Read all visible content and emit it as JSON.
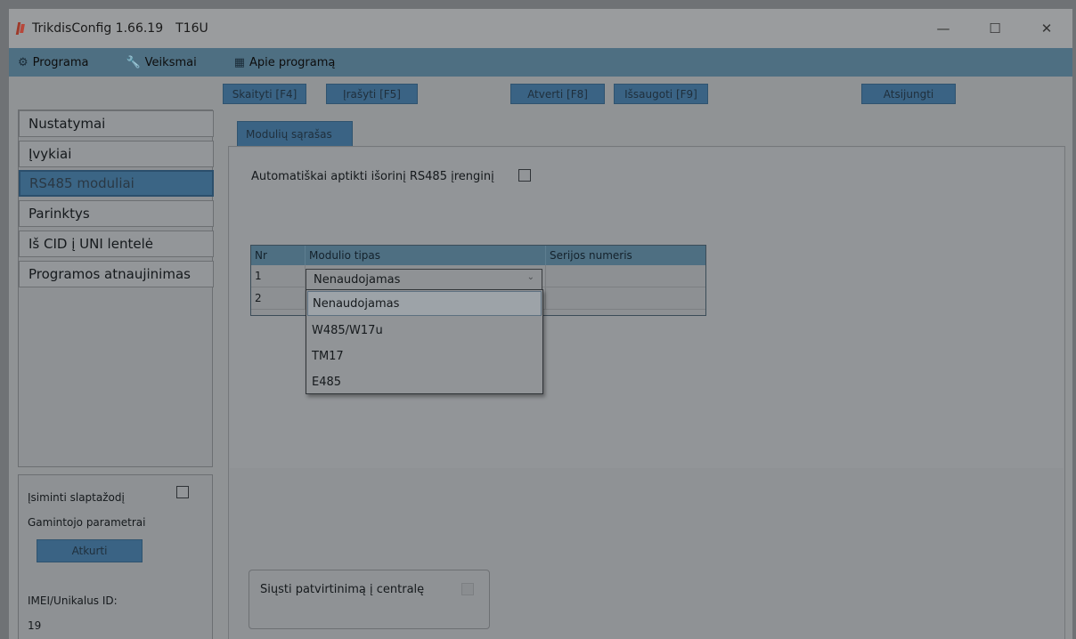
{
  "window": {
    "title": "TrikdisConfig 1.66.19",
    "device": "T16U",
    "controls": {
      "minimize": "—",
      "maximize": "☐",
      "close": "✕"
    }
  },
  "menu": {
    "items": [
      {
        "label": "Programa",
        "icon": "gear-icon"
      },
      {
        "label": "Veiksmai",
        "icon": "wrench-icon"
      },
      {
        "label": "Apie programą",
        "icon": "book-icon"
      }
    ]
  },
  "toolbar": {
    "read": "Skaityti [F4]",
    "write": "Įrašyti [F5]",
    "open": "Atverti [F8]",
    "save": "Išsaugoti [F9]",
    "disconnect": "Atsijungti"
  },
  "sidebar": {
    "items": [
      {
        "label": "Nustatymai"
      },
      {
        "label": "Įvykiai"
      },
      {
        "label": "RS485 moduliai"
      },
      {
        "label": "Parinktys"
      },
      {
        "label": "Iš CID į UNI lentelė"
      },
      {
        "label": "Programos atnaujinimas"
      }
    ],
    "active_index": 2,
    "remember_password": "Įsiminti slaptažodį",
    "factory_params": "Gamintojo parametrai",
    "restore": "Atkurti",
    "imei_label": "IMEI/Unikalus ID:",
    "imei_value": "19"
  },
  "main": {
    "tab": "Modulių sąrašas",
    "auto_detect_label": "Automatiškai aptikti išorinį RS485 įrenginį",
    "table": {
      "headers": [
        "Nr",
        "Modulio tipas",
        "Serijos numeris"
      ],
      "rows": [
        {
          "nr": "1",
          "type": "Nenaudojamas",
          "serial": ""
        },
        {
          "nr": "2",
          "type": "",
          "serial": ""
        }
      ]
    },
    "dropdown": {
      "selected": "Nenaudojamas",
      "options": [
        "Nenaudojamas",
        "W485/W17u",
        "TM17",
        "E485"
      ]
    },
    "send_confirm_label": "Siųsti patvirtinimą į centralę"
  }
}
